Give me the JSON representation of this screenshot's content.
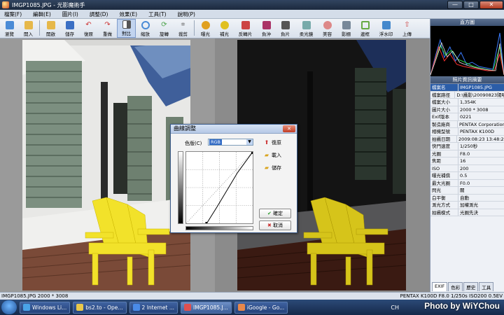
{
  "window": {
    "title": "IMGP1085.JPG - 光影魔術手",
    "min": "—",
    "max": "□",
    "close": "✕"
  },
  "menu": [
    "檔案(F)",
    "編輯(E)",
    "圖片(I)",
    "調整(D)",
    "效果(E)",
    "工具(T)",
    "說明(P)"
  ],
  "toolbar": [
    {
      "label": "瀏覽",
      "icon": "browse-icon",
      "color": "#4a8bd6"
    },
    {
      "label": "開入",
      "icon": "open-icon",
      "color": "#e6b84a"
    },
    {
      "label": "開啟",
      "icon": "folder-icon",
      "color": "#e6b84a"
    },
    {
      "label": "儲存",
      "icon": "save-icon",
      "color": "#3b6fc4"
    },
    {
      "label": "復原",
      "icon": "undo-icon",
      "color": "#c33"
    },
    {
      "label": "重做",
      "icon": "redo-icon",
      "color": "#c33"
    },
    {
      "label": "對比",
      "icon": "compare-icon",
      "color": "#6a6a6a"
    },
    {
      "label": "縮放",
      "icon": "zoom-icon",
      "color": "#4a8bd6"
    },
    {
      "label": "旋轉",
      "icon": "rotate-icon",
      "color": "#4ca34c"
    },
    {
      "label": "裁剪",
      "icon": "crop-icon",
      "color": "#555"
    },
    {
      "label": "曝光",
      "icon": "exposure-icon",
      "color": "#e0a020"
    },
    {
      "label": "補光",
      "icon": "fill-light-icon",
      "color": "#e0c020"
    },
    {
      "label": "反轉片",
      "icon": "reversal-icon",
      "color": "#c44"
    },
    {
      "label": "負沖",
      "icon": "negative-icon",
      "color": "#a36"
    },
    {
      "label": "負片",
      "icon": "film-icon",
      "color": "#555"
    },
    {
      "label": "柔光鏡",
      "icon": "soft-light-icon",
      "color": "#7aa"
    },
    {
      "label": "美容",
      "icon": "beauty-icon",
      "color": "#d88"
    },
    {
      "label": "影棚",
      "icon": "studio-icon",
      "color": "#789"
    },
    {
      "label": "邊框",
      "icon": "frame-icon",
      "color": "#6a4"
    },
    {
      "label": "浮水印",
      "icon": "watermark-icon",
      "color": "#48c"
    },
    {
      "label": "上傳",
      "icon": "upload-icon",
      "color": "#c44"
    }
  ],
  "side": {
    "histogram_title": "直方圖",
    "info_title": "照片資訊摘要",
    "properties": [
      {
        "k": "檔案名",
        "v": "IMGP1085.JPG"
      },
      {
        "k": "檔案路徑",
        "v": "D:\\攝影\\20090823陽明山"
      },
      {
        "k": "檔案大小",
        "v": "1,354K"
      },
      {
        "k": "圖片大小",
        "v": "2000 * 3008"
      },
      {
        "k": "Exif版本",
        "v": "0221"
      },
      {
        "k": "製造廠商",
        "v": "PENTAX Corporation"
      },
      {
        "k": "相機型號",
        "v": "PENTAX K100D"
      },
      {
        "k": "拍攝日期",
        "v": "2009:08:23 13:48:28"
      },
      {
        "k": "快門速度",
        "v": "1/250秒"
      },
      {
        "k": "光圈",
        "v": "F8.0"
      },
      {
        "k": "焦距",
        "v": "16"
      },
      {
        "k": "ISO",
        "v": "200"
      },
      {
        "k": "曝光補償",
        "v": "0.5"
      },
      {
        "k": "最大光圈",
        "v": "F0.0"
      },
      {
        "k": "閃光",
        "v": "關"
      },
      {
        "k": "白平衡",
        "v": "自動"
      },
      {
        "k": "測光方式",
        "v": "加權測光"
      },
      {
        "k": "拍攝模式",
        "v": "光圈先決"
      }
    ],
    "tabs": [
      "EXIF",
      "色彩",
      "歷史",
      "工具"
    ]
  },
  "status": {
    "left": "IMGP1085.JPG  2000 * 3008",
    "right": "PENTAX K100D F8.0 1/250s ISO200 0.5EV"
  },
  "dialog": {
    "title": "曲線調整",
    "channel_label": "色版(C)",
    "channel_value": "RGB",
    "reset": "復原",
    "load": "載入",
    "save": "儲存",
    "ok": "確定",
    "cancel": "取消"
  },
  "taskbar": {
    "tasks": [
      {
        "label": "Windows Li...",
        "color": "#4aa3e8"
      },
      {
        "label": "bs2.to - Ope...",
        "color": "#e8c84a"
      },
      {
        "label": "2 Internet ...",
        "color": "#4a8be8"
      },
      {
        "label": "IMGP1085.J...",
        "color": "#e05050"
      },
      {
        "label": "iGoogle - Go...",
        "color": "#e8884a"
      }
    ],
    "lang": "CH"
  },
  "watermark": "Photo by WiYChou"
}
